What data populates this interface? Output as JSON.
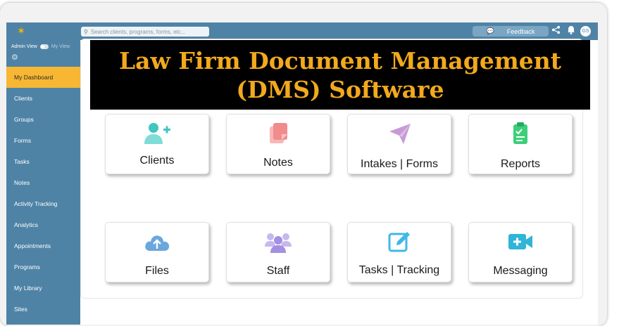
{
  "topbar": {
    "search_placeholder": "Search clients, programs, forms, etc...",
    "feedback_label": "Feedback",
    "avatar_initials": "GS"
  },
  "sidebar": {
    "admin_view_label": "Admin View",
    "my_view_label": "My View",
    "items": [
      {
        "label": "My Dashboard",
        "active": true
      },
      {
        "label": "Clients"
      },
      {
        "label": "Groups"
      },
      {
        "label": "Forms"
      },
      {
        "label": "Tasks"
      },
      {
        "label": "Notes"
      },
      {
        "label": "Activity Tracking"
      },
      {
        "label": "Analytics"
      },
      {
        "label": "Appointments"
      },
      {
        "label": "Programs"
      },
      {
        "label": "My Library"
      },
      {
        "label": "Sites"
      }
    ]
  },
  "banner": {
    "line1": "Law Firm Document Management",
    "line2": "(DMS) Software"
  },
  "cards": [
    {
      "label": "Clients",
      "icon": "add-user-icon",
      "color": "#3fc6c0"
    },
    {
      "label": "Notes",
      "icon": "notes-icon",
      "color": "#f28b8b"
    },
    {
      "label": "Intakes | Forms",
      "icon": "paper-plane-icon",
      "color": "#c79ad6"
    },
    {
      "label": "Reports",
      "icon": "clipboard-check-icon",
      "color": "#3ccf7a"
    },
    {
      "label": "Files",
      "icon": "cloud-upload-icon",
      "color": "#6aa7dd"
    },
    {
      "label": "Staff",
      "icon": "group-icon",
      "color": "#a48fe0"
    },
    {
      "label": "Tasks | Tracking",
      "icon": "edit-icon",
      "color": "#3fb8e6"
    },
    {
      "label": "Messaging",
      "icon": "video-call-icon",
      "color": "#2fb5d8"
    }
  ],
  "colors": {
    "topbar": "#4f83a6",
    "sidebar": "#4f83a6",
    "active_nav": "#f7b733",
    "banner_text": "#f2a91d"
  }
}
